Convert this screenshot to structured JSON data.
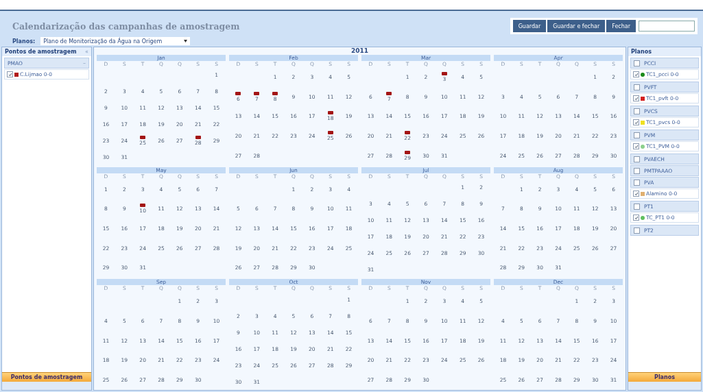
{
  "window": {
    "title": "Calendarização das campanhas de amostragem"
  },
  "toolbar": {
    "buttons": [
      "Guardar",
      "Guardar e fechar",
      "Fechar"
    ]
  },
  "plan_selector": {
    "label": "Planos:",
    "value": "Plano de Monitorização da Água na Origem"
  },
  "left_panel": {
    "title": "Pontos de amostragem",
    "collapse": "«",
    "groups": [
      {
        "name": "PMAO",
        "toggle": "–",
        "points": [
          {
            "name": "C.Lijmao 0-0",
            "checked": true,
            "color": "#b01818",
            "kind": "square"
          }
        ]
      }
    ],
    "footer": "Pontos de amostragem"
  },
  "calendar": {
    "year": "2011",
    "months": [
      {
        "name": "Jan",
        "weekdays": [
          "D",
          "S",
          "T",
          "Q",
          "Q",
          "S",
          "S"
        ],
        "weeks": [
          [
            "1"
          ],
          [
            "2",
            "3",
            "4",
            "5",
            "6",
            "7",
            "8"
          ],
          [
            "9",
            "10",
            "11",
            "12",
            "13",
            "14",
            "15"
          ],
          [
            "16",
            "17",
            "18",
            "19",
            "20",
            "21",
            "22"
          ],
          [
            "23",
            "24",
            {
              "day": "25",
              "marked": true
            },
            "26",
            "27",
            {
              "day": "28",
              "marked": true
            },
            "29"
          ],
          [
            "30",
            "31"
          ]
        ]
      },
      {
        "name": "Feb",
        "weekdays": [
          "D",
          "S",
          "T",
          "Q",
          "Q",
          "S",
          "S"
        ],
        "weeks": [
          [
            "1",
            "2",
            "3",
            "4",
            "5"
          ],
          [
            {
              "day": "6",
              "marked": true
            },
            {
              "day": "7",
              "marked": true
            },
            {
              "day": "8",
              "marked": true
            },
            "9",
            "10",
            "11",
            "12"
          ],
          [
            "13",
            "14",
            "15",
            "16",
            "17",
            {
              "day": "18",
              "marked": true
            },
            "19"
          ],
          [
            "20",
            "21",
            "22",
            "23",
            "24",
            {
              "day": "25",
              "marked": true
            },
            "26"
          ],
          [
            "27",
            "28"
          ]
        ]
      },
      {
        "name": "Mar",
        "weekdays": [
          "D",
          "S",
          "T",
          "Q",
          "Q",
          "S",
          "S"
        ],
        "weeks": [
          [
            "1",
            "2",
            {
              "day": "3",
              "marked": true
            },
            "4",
            "5"
          ],
          [
            "6",
            {
              "day": "7",
              "marked": true
            },
            "8",
            "9",
            "10",
            "11",
            "12"
          ],
          [
            "13",
            "14",
            "15",
            "16",
            "17",
            "18",
            "19"
          ],
          [
            "20",
            "21",
            {
              "day": "22",
              "marked": true
            },
            "23",
            "24",
            "25",
            "26"
          ],
          [
            "27",
            "28",
            {
              "day": "29",
              "marked": true
            },
            "30",
            "31"
          ]
        ]
      },
      {
        "name": "Apr",
        "weekdays": [
          "D",
          "S",
          "T",
          "Q",
          "Q",
          "S",
          "S"
        ],
        "weeks": [
          [
            "1",
            "2"
          ],
          [
            "3",
            "4",
            "5",
            "6",
            "7",
            "8",
            "9"
          ],
          [
            "10",
            "11",
            "12",
            "13",
            "14",
            "15",
            "16"
          ],
          [
            "17",
            "18",
            "19",
            "20",
            "21",
            "22",
            "23"
          ],
          [
            "24",
            "25",
            "26",
            "27",
            "28",
            "29",
            "30"
          ]
        ]
      },
      {
        "name": "May",
        "weekdays": [
          "D",
          "S",
          "T",
          "Q",
          "Q",
          "S",
          "S"
        ],
        "weeks": [
          [
            "1",
            "2",
            "3",
            "4",
            "5",
            "6",
            "7"
          ],
          [
            "8",
            "9",
            {
              "day": "10",
              "marked": true
            },
            "11",
            "12",
            "13",
            "14"
          ],
          [
            "15",
            "16",
            "17",
            "18",
            "19",
            "20",
            "21"
          ],
          [
            "22",
            "23",
            "24",
            "25",
            "26",
            "27",
            "28"
          ],
          [
            "29",
            "30",
            "31"
          ]
        ]
      },
      {
        "name": "Jun",
        "weekdays": [
          "D",
          "S",
          "T",
          "Q",
          "Q",
          "S",
          "S"
        ],
        "weeks": [
          [
            "1",
            "2",
            "3",
            "4"
          ],
          [
            "5",
            "6",
            "7",
            "8",
            "9",
            "10",
            "11"
          ],
          [
            "12",
            "13",
            "14",
            "15",
            "16",
            "17",
            "18"
          ],
          [
            "19",
            "20",
            "21",
            "22",
            "23",
            "24",
            "25"
          ],
          [
            "26",
            "27",
            "28",
            "29",
            "30"
          ]
        ]
      },
      {
        "name": "Jul",
        "weekdays": [
          "D",
          "S",
          "T",
          "Q",
          "Q",
          "S",
          "S"
        ],
        "weeks": [
          [
            "1",
            "2"
          ],
          [
            "3",
            "4",
            "5",
            "6",
            "7",
            "8",
            "9"
          ],
          [
            "10",
            "11",
            "12",
            "13",
            "14",
            "15",
            "16"
          ],
          [
            "17",
            "18",
            "19",
            "20",
            "21",
            "22",
            "23"
          ],
          [
            "24",
            "25",
            "26",
            "27",
            "28",
            "29",
            "30"
          ],
          [
            "31"
          ]
        ]
      },
      {
        "name": "Aug",
        "weekdays": [
          "D",
          "S",
          "T",
          "Q",
          "Q",
          "S",
          "S"
        ],
        "weeks": [
          [
            "1",
            "2",
            "3",
            "4",
            "5",
            "6"
          ],
          [
            "7",
            "8",
            "9",
            "10",
            "11",
            "12",
            "13"
          ],
          [
            "14",
            "15",
            "16",
            "17",
            "18",
            "19",
            "20"
          ],
          [
            "21",
            "22",
            "23",
            "24",
            "25",
            "26",
            "27"
          ],
          [
            "28",
            "29",
            "30",
            "31"
          ]
        ]
      },
      {
        "name": "Sep",
        "weekdays": [
          "D",
          "S",
          "T",
          "Q",
          "Q",
          "S",
          "S"
        ],
        "weeks": [
          [
            "1",
            "2",
            "3"
          ],
          [
            "4",
            "5",
            "6",
            "7",
            "8",
            "9",
            "10"
          ],
          [
            "11",
            "12",
            "13",
            "14",
            "15",
            "16",
            "17"
          ],
          [
            "18",
            "19",
            "20",
            "21",
            "22",
            "23",
            "24"
          ],
          [
            "25",
            "26",
            "27",
            "28",
            "29",
            "30"
          ]
        ]
      },
      {
        "name": "Oct",
        "weekdays": [
          "D",
          "S",
          "T",
          "Q",
          "Q",
          "S",
          "S"
        ],
        "weeks": [
          [
            "1"
          ],
          [
            "2",
            "3",
            "4",
            "5",
            "6",
            "7",
            "8"
          ],
          [
            "9",
            "10",
            "11",
            "12",
            "13",
            "14",
            "15"
          ],
          [
            "16",
            "17",
            "18",
            "19",
            "20",
            "21",
            "22"
          ],
          [
            "23",
            "24",
            "25",
            "26",
            "27",
            "28",
            "29"
          ],
          [
            "30",
            "31"
          ]
        ]
      },
      {
        "name": "Nov",
        "weekdays": [
          "D",
          "S",
          "T",
          "Q",
          "Q",
          "S",
          "S"
        ],
        "weeks": [
          [
            "1",
            "2",
            "3",
            "4",
            "5"
          ],
          [
            "6",
            "7",
            "8",
            "9",
            "10",
            "11",
            "12"
          ],
          [
            "13",
            "14",
            "15",
            "16",
            "17",
            "18",
            "19"
          ],
          [
            "20",
            "21",
            "22",
            "23",
            "24",
            "25",
            "26"
          ],
          [
            "27",
            "28",
            "29",
            "30"
          ]
        ]
      },
      {
        "name": "Dec",
        "weekdays": [
          "D",
          "S",
          "T",
          "Q",
          "Q",
          "S",
          "S"
        ],
        "weeks": [
          [
            "1",
            "2",
            "3"
          ],
          [
            "4",
            "5",
            "6",
            "7",
            "8",
            "9",
            "10"
          ],
          [
            "11",
            "12",
            "13",
            "14",
            "15",
            "16",
            "17"
          ],
          [
            "18",
            "19",
            "20",
            "21",
            "22",
            "23",
            "24"
          ],
          [
            "25",
            "26",
            "27",
            "28",
            "29",
            "30",
            "31"
          ]
        ]
      }
    ]
  },
  "right_panel": {
    "title": "Planos",
    "plans": [
      {
        "name": "PCCI",
        "checked": false,
        "points": [
          {
            "name": "TC1_pcci 0-0",
            "checked": true,
            "color": "#1a8a1a",
            "kind": "dot"
          }
        ]
      },
      {
        "name": "PVFT",
        "checked": false,
        "points": [
          {
            "name": "TC1_pvft 0-0",
            "checked": true,
            "color": "#d42020",
            "kind": "square"
          }
        ]
      },
      {
        "name": "PVCS",
        "checked": false,
        "points": [
          {
            "name": "TC1_pvcs 0-0",
            "checked": true,
            "color": "#f0e020",
            "kind": "square"
          }
        ]
      },
      {
        "name": "PVM",
        "checked": false,
        "points": [
          {
            "name": "TC1_PVM 0-0",
            "checked": true,
            "color": "#8cd08c",
            "kind": "dot"
          }
        ]
      },
      {
        "name": "PVAECH",
        "checked": false
      },
      {
        "name": "PMTPAAAO",
        "checked": false
      },
      {
        "name": "PVA",
        "checked": false,
        "points": [
          {
            "name": "Alamino 0-0",
            "checked": true,
            "color": "#e0b070",
            "kind": "square"
          }
        ]
      },
      {
        "name": "PT1",
        "checked": false,
        "points": [
          {
            "name": "TC_PT1 0-0",
            "checked": true,
            "color": "#60c060",
            "kind": "dot"
          }
        ]
      },
      {
        "name": "PT2",
        "checked": false
      }
    ],
    "footer": "Planos"
  }
}
